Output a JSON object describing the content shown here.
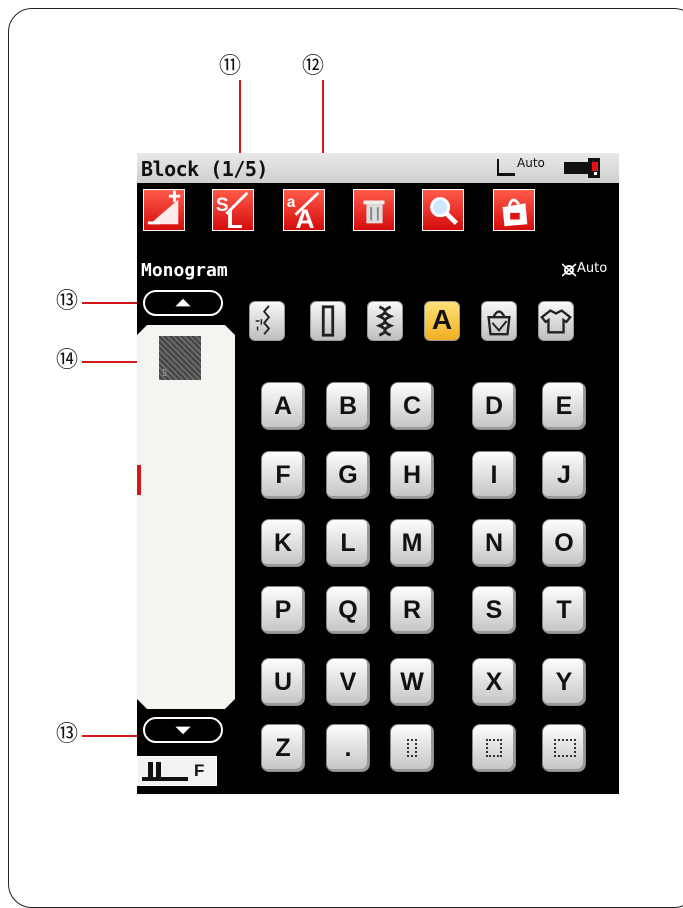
{
  "callouts": {
    "c11": "⑪",
    "c12": "⑫",
    "c13_top": "⑬",
    "c14": "⑭",
    "c13_bottom": "⑬"
  },
  "titlebar": {
    "title": "Block (1/5)",
    "foot_auto": "Auto",
    "icons": [
      "presser-foot-icon",
      "thread-cutter-icon"
    ]
  },
  "toolbar": {
    "buttons": [
      {
        "name": "stitch-width-button",
        "icon": "plus-minus-icon"
      },
      {
        "name": "letter-size-button",
        "icon": "letter-L-icon"
      },
      {
        "name": "letter-case-button",
        "icon": "letter-case-A-icon"
      },
      {
        "name": "delete-button",
        "icon": "trash-icon"
      },
      {
        "name": "zoom-button",
        "icon": "magnifier-icon"
      },
      {
        "name": "save-button",
        "icon": "save-bag-icon"
      }
    ],
    "accent": "#e01414"
  },
  "mode": {
    "label": "Monogram",
    "tension_auto": "Auto"
  },
  "categories": [
    {
      "name": "category-stitches",
      "active": false
    },
    {
      "name": "category-buttonhole",
      "active": false
    },
    {
      "name": "category-decorative",
      "active": false
    },
    {
      "name": "category-monogram",
      "label": "A",
      "active": true
    },
    {
      "name": "category-bag",
      "active": false
    },
    {
      "name": "category-shirt",
      "active": false
    }
  ],
  "keys": [
    [
      "A",
      "B",
      "C",
      "D",
      "E"
    ],
    [
      "F",
      "G",
      "H",
      "I",
      "J"
    ],
    [
      "K",
      "L",
      "M",
      "N",
      "O"
    ],
    [
      "P",
      "Q",
      "R",
      "S",
      "T"
    ],
    [
      "U",
      "V",
      "W",
      "X",
      "Y"
    ],
    [
      "Z",
      ".",
      "",
      "",
      ""
    ]
  ],
  "footer": {
    "foot_label": "F"
  }
}
